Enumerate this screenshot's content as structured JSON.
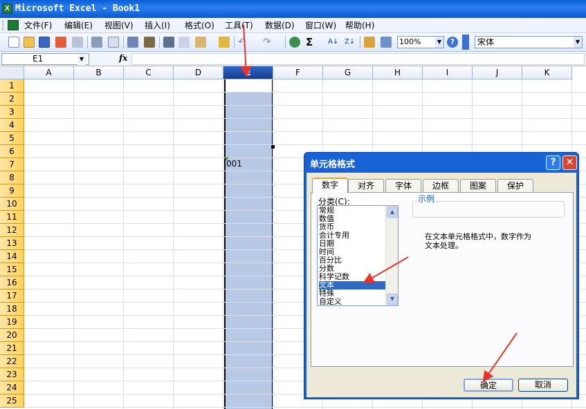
{
  "window": {
    "title": "Microsoft Excel - Book1",
    "app_icon": "X"
  },
  "menu": [
    "文件(F)",
    "编辑(E)",
    "视图(V)",
    "插入(I)",
    "格式(O)",
    "工具(T)",
    "数据(D)",
    "窗口(W)",
    "帮助(H)"
  ],
  "toolbar": {
    "zoom": "100%",
    "font": "宋体",
    "sum_symbol": "Σ"
  },
  "formula_bar": {
    "name_box": "E1",
    "fx": "fx",
    "formula": ""
  },
  "sheet": {
    "columns": [
      "A",
      "B",
      "C",
      "D",
      "E",
      "F",
      "G",
      "H",
      "I",
      "J",
      "K"
    ],
    "rows": [
      "1",
      "2",
      "3",
      "4",
      "5",
      "6",
      "7",
      "8",
      "9",
      "10",
      "11",
      "12",
      "13",
      "14",
      "15",
      "16",
      "17",
      "18",
      "19",
      "20",
      "21",
      "22",
      "23",
      "24",
      "25"
    ],
    "selected_column": "E",
    "cell_e7": "001"
  },
  "dialog": {
    "title": "单元格格式",
    "help": "?",
    "close": "✕",
    "tabs": [
      "数字",
      "对齐",
      "字体",
      "边框",
      "图案",
      "保护"
    ],
    "active_tab": "数字",
    "category_label": "分类(C):",
    "categories": [
      "常规",
      "数值",
      "货币",
      "会计专用",
      "日期",
      "时间",
      "百分比",
      "分数",
      "科学记数",
      "文本",
      "特殊",
      "自定义"
    ],
    "selected_category": "文本",
    "sample_legend": "示例",
    "description_line1": "在文本单元格格式中，数字作为",
    "description_line2": "文本处理。",
    "ok": "确定",
    "cancel": "取消"
  },
  "colors": {
    "title_bar": "#0a5fd8",
    "selection": "#316ac5",
    "column_highlight": "#b8c9e6",
    "arrow": "#e8332a"
  }
}
